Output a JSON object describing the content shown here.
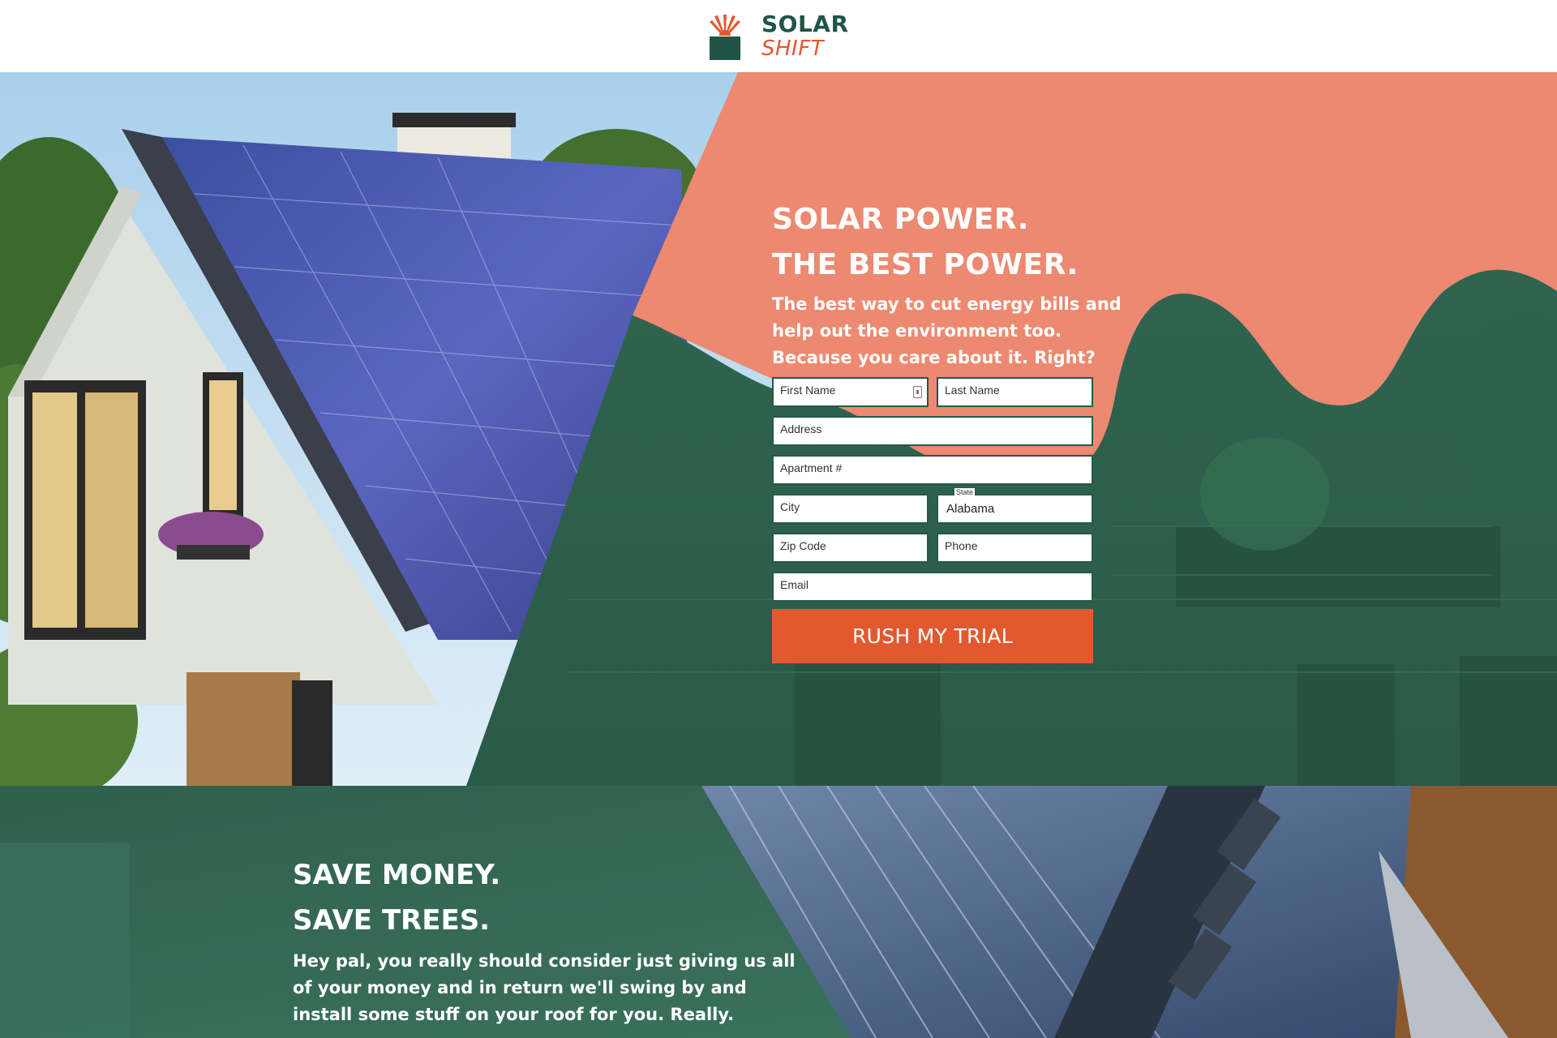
{
  "brand": {
    "line1": "SOLAR",
    "line2": "SHIFT",
    "colors": {
      "green": "#1f5446",
      "orange": "#e2592f",
      "salmon": "#ec8970",
      "teal_overlay": "#2e6554"
    }
  },
  "hero": {
    "headline_1": "SOLAR POWER.",
    "headline_2": "THE BEST POWER.",
    "subtext": "The best way to cut energy bills and help out the environment too. Because you care about it. Right?"
  },
  "form": {
    "first_name_placeholder": "First Name",
    "last_name_placeholder": "Last Name",
    "address_placeholder": "Address",
    "apartment_placeholder": "Apartment #",
    "city_placeholder": "City",
    "state_label": "State",
    "state_value": "Alabama",
    "zip_placeholder": "Zip Code",
    "phone_placeholder": "Phone",
    "email_placeholder": "Email",
    "submit_label": "RUSH MY TRIAL"
  },
  "lower": {
    "headline_1": "SAVE MONEY.",
    "headline_2": "SAVE TREES.",
    "body": "Hey pal, you really should consider just giving us all of your money and in return we'll swing by and install some stuff on your roof for you. Really."
  }
}
